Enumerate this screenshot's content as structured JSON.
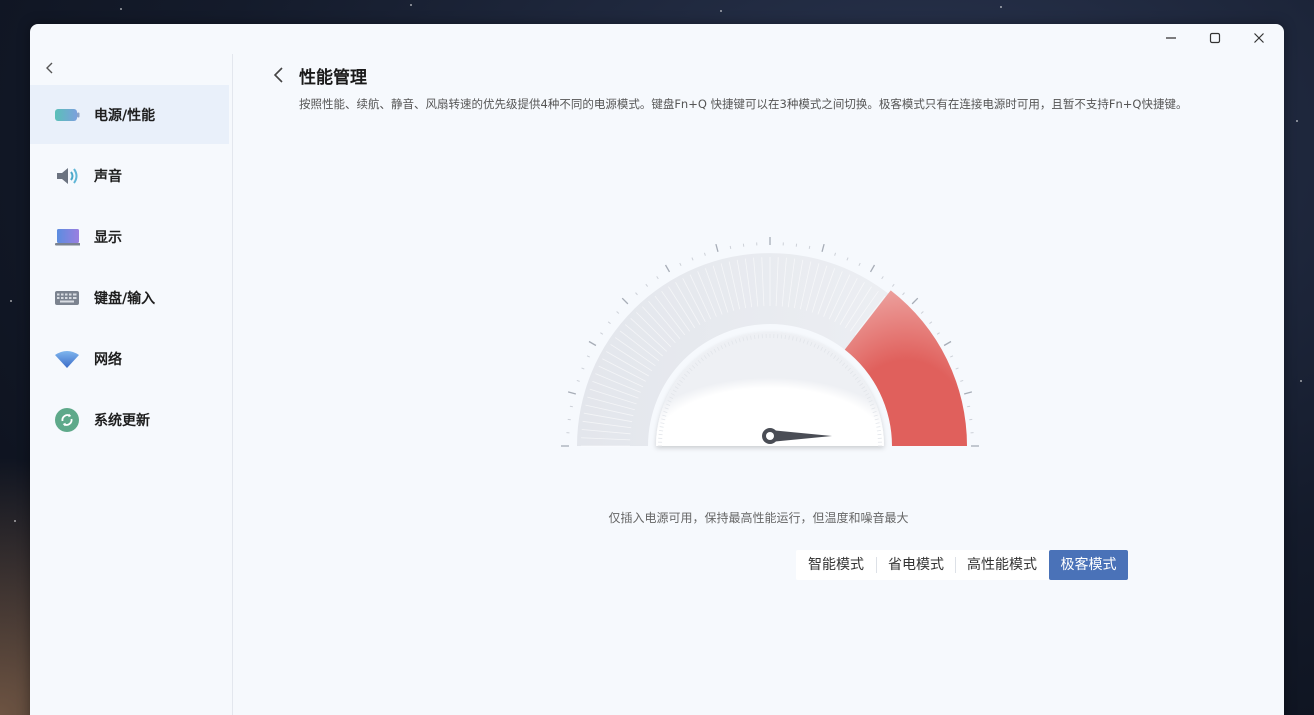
{
  "window": {
    "minimize_icon": "minimize-icon",
    "maximize_icon": "maximize-icon",
    "close_icon": "close-icon"
  },
  "sidebar": {
    "back_icon": "chevron-left-icon",
    "items": [
      {
        "label": "电源/性能",
        "icon": "battery-icon",
        "active": true
      },
      {
        "label": "声音",
        "icon": "speaker-icon",
        "active": false
      },
      {
        "label": "显示",
        "icon": "display-icon",
        "active": false
      },
      {
        "label": "键盘/输入",
        "icon": "keyboard-icon",
        "active": false
      },
      {
        "label": "网络",
        "icon": "wifi-icon",
        "active": false
      },
      {
        "label": "系统更新",
        "icon": "refresh-icon",
        "active": false
      }
    ]
  },
  "main": {
    "title": "性能管理",
    "description": "按照性能、续航、静音、风扇转速的优先级提供4种不同的电源模式。键盘Fn+Q 快捷键可以在3种模式之间切换。极客模式只有在连接电源时可用，且暂不支持Fn+Q快捷键。",
    "mode_description": "仅插入电源可用，保持最高性能运行，但温度和噪音最大",
    "modes": [
      {
        "label": "智能模式",
        "active": false
      },
      {
        "label": "省电模式",
        "active": false
      },
      {
        "label": "高性能模式",
        "active": false
      },
      {
        "label": "极客模式",
        "active": true
      }
    ]
  },
  "gauge": {
    "level_fraction": 1.0,
    "accent_color": "#e0605c"
  },
  "colors": {
    "accent": "#4a72b8",
    "active_nav_bg": "#e9f0fa"
  }
}
